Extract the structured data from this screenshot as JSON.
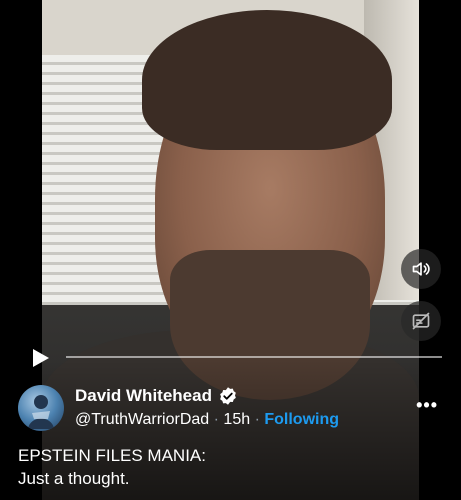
{
  "video": {
    "progress": 0.0,
    "volume_icon": "volume-icon",
    "captions_icon": "captions-off-icon",
    "play_icon": "play-icon"
  },
  "author": {
    "name": "David Whitehead",
    "verified_icon": "verified-badge-icon",
    "handle": "@TruthWarriorDad",
    "separator": "·",
    "time": "15h",
    "follow_status": "Following",
    "more_label": "•••"
  },
  "tweet": {
    "line1": "EPSTEIN FILES MANIA:",
    "line2": "Just a thought."
  },
  "colors": {
    "accent": "#1d9bf0",
    "background": "#000000"
  }
}
